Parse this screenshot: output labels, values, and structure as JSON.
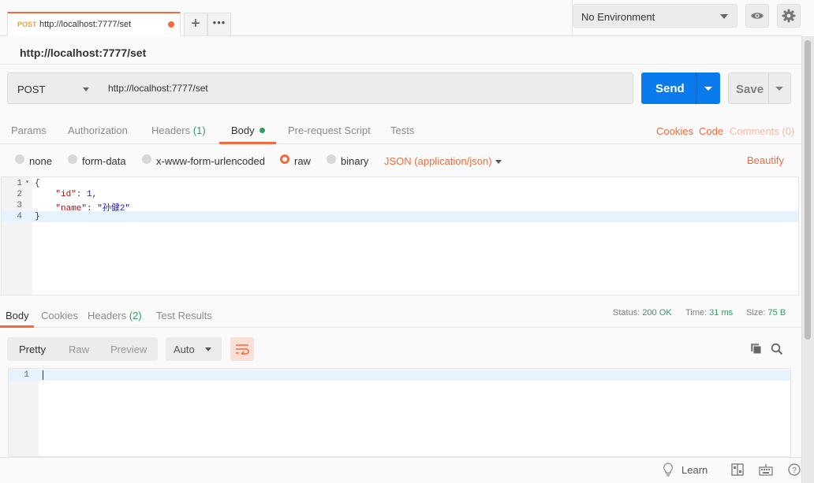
{
  "tab": {
    "method": "POST",
    "url": "http://localhost:7777/set"
  },
  "environment": {
    "selected": "No Environment"
  },
  "request": {
    "title": "http://localhost:7777/set",
    "method": "POST",
    "url": "http://localhost:7777/set",
    "send_label": "Send",
    "save_label": "Save"
  },
  "request_tabs": {
    "params": "Params",
    "authorization": "Authorization",
    "headers": "Headers",
    "headers_count": "(1)",
    "body": "Body",
    "prerequest": "Pre-request Script",
    "tests": "Tests",
    "cookies": "Cookies",
    "code": "Code",
    "comments": "Comments (0)"
  },
  "body_types": {
    "none": "none",
    "form_data": "form-data",
    "urlencoded": "x-www-form-urlencoded",
    "raw": "raw",
    "binary": "binary",
    "content_type": "JSON (application/json)",
    "beautify": "Beautify",
    "selected": "raw"
  },
  "editor": {
    "lines": [
      {
        "num": "1",
        "text": "{"
      },
      {
        "num": "2",
        "key": "\"id\"",
        "value": "1",
        "suffix": ","
      },
      {
        "num": "3",
        "key": "\"name\"",
        "value": "\"孙健2\""
      },
      {
        "num": "4",
        "text": "}"
      }
    ],
    "current_line": 4
  },
  "response": {
    "tabs": {
      "body": "Body",
      "cookies": "Cookies",
      "headers": "Headers",
      "headers_count": "(2)",
      "tests": "Test Results"
    },
    "status_label": "Status:",
    "status_value": "200 OK",
    "time_label": "Time:",
    "time_value": "31 ms",
    "size_label": "Size:",
    "size_value": "75 B",
    "formats": {
      "pretty": "Pretty",
      "raw": "Raw",
      "preview": "Preview"
    },
    "auto_label": "Auto",
    "line_num": "1"
  },
  "statusbar": {
    "learn": "Learn"
  },
  "colors": {
    "accent": "#f26b3a",
    "send": "#097bed",
    "success": "#2b9f60"
  }
}
